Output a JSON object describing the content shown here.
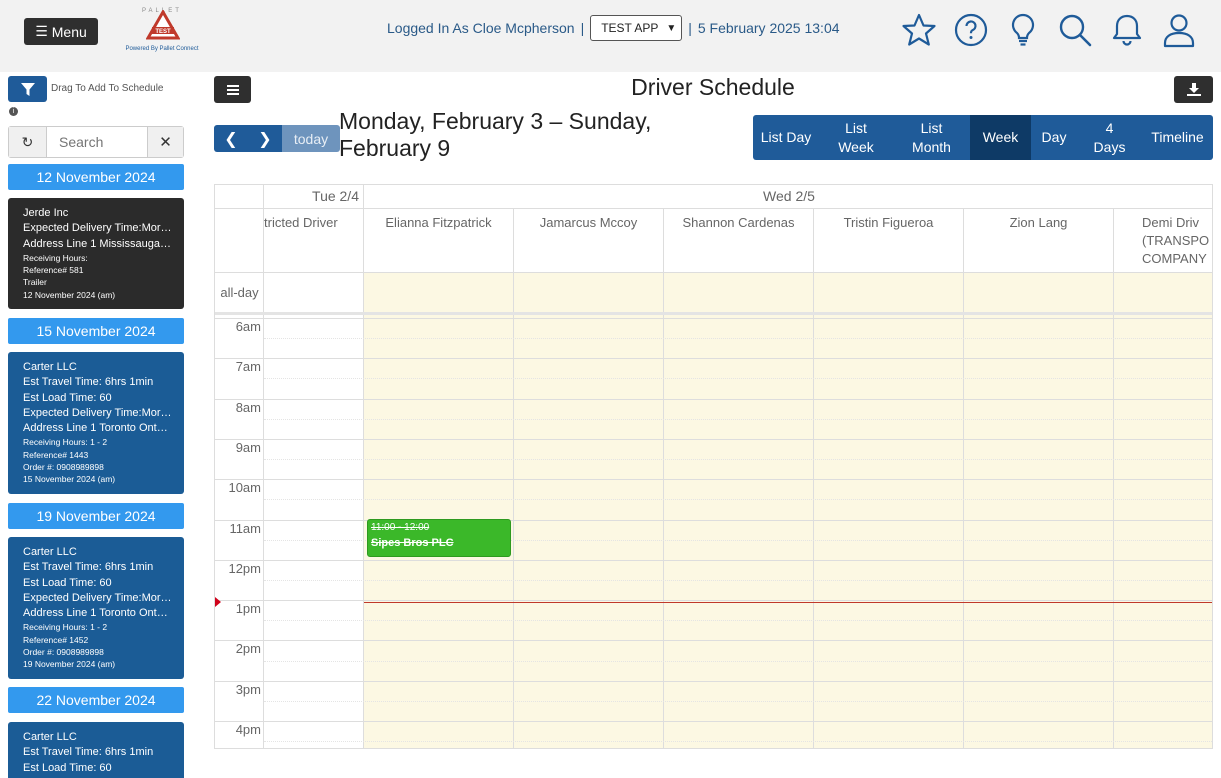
{
  "header": {
    "menu_label": "Menu",
    "logo_top_text": "PALLET",
    "logo_badge": "TEST",
    "logo_caption": "Powered By Pallet Connect",
    "logged_in_text": "Logged In As Cloe Mcpherson",
    "separator": "|",
    "app_select": "TEST APP",
    "datetime": "5 February 2025 13:04",
    "icons": [
      "star-icon",
      "help-icon",
      "lightbulb-icon",
      "search-icon",
      "bell-icon",
      "user-icon"
    ]
  },
  "sidebar": {
    "drag_text": "Drag To Add To Schedule",
    "search_placeholder": "Search",
    "groups": [
      {
        "date": "12 November 2024",
        "card": {
          "lines": [
            "Jerde Inc",
            "Expected Delivery Time:Mor…",
            "Address Line 1 Mississauga …"
          ],
          "small_lines": [
            "Receiving Hours:",
            "Reference# 581",
            "Trailer",
            "12 November 2024 (am)"
          ]
        }
      },
      {
        "date": "15 November 2024",
        "card": {
          "lines": [
            "Carter LLC",
            "Est Travel Time: 6hrs 1min",
            "Est Load Time: 60",
            "Expected Delivery Time:Mor…",
            "Address Line 1 Toronto Ont…"
          ],
          "small_lines": [
            "Receiving Hours: 1 - 2",
            "Reference# 1443",
            "Order #: 0908989898",
            "15 November 2024 (am)"
          ]
        }
      },
      {
        "date": "19 November 2024",
        "card": {
          "lines": [
            "Carter LLC",
            "Est Travel Time: 6hrs 1min",
            "Est Load Time: 60",
            "Expected Delivery Time:Mor…",
            "Address Line 1 Toronto Ont…"
          ],
          "small_lines": [
            "Receiving Hours: 1 - 2",
            "Reference# 1452",
            "Order #: 0908989898",
            "19 November 2024 (am)"
          ]
        }
      },
      {
        "date": "22 November 2024",
        "card": {
          "lines": [
            "Carter LLC",
            "Est Travel Time: 6hrs 1min",
            "Est Load Time: 60"
          ],
          "small_lines": []
        }
      }
    ]
  },
  "main": {
    "title": "Driver Schedule",
    "today_label": "today",
    "range_title": "Monday, February 3 – Sunday, February 9",
    "views": [
      {
        "label": "List Day",
        "active": false
      },
      {
        "label": "List Week",
        "active": false
      },
      {
        "label": "List Month",
        "active": false
      },
      {
        "label": "Week",
        "active": true
      },
      {
        "label": "Day",
        "active": false
      },
      {
        "label": "4 Days",
        "active": false
      },
      {
        "label": "Timeline",
        "active": false
      }
    ]
  },
  "calendar": {
    "days": [
      "Tue 2/4",
      "Wed 2/5"
    ],
    "resources": [
      "tricted Driver",
      "Elianna Fitzpatrick",
      "Jamarcus Mccoy",
      "Shannon Cardenas",
      "Tristin Figueroa",
      "Zion Lang",
      "Demi Driv (TRANSPO COMPANY"
    ],
    "all_day_label": "all-day",
    "hours": [
      "6am",
      "7am",
      "8am",
      "9am",
      "10am",
      "11am",
      "12pm",
      "1pm",
      "2pm",
      "3pm",
      "4pm"
    ],
    "event": {
      "time": "11:00 - 12:00",
      "title": "Sipes Bros PLC"
    },
    "colors": {
      "primary": "#1f5b99",
      "active_view": "#0e3a66",
      "today_bg": "#fcf8e3",
      "event": "#3bb829",
      "now_line": "#c0392b"
    }
  }
}
